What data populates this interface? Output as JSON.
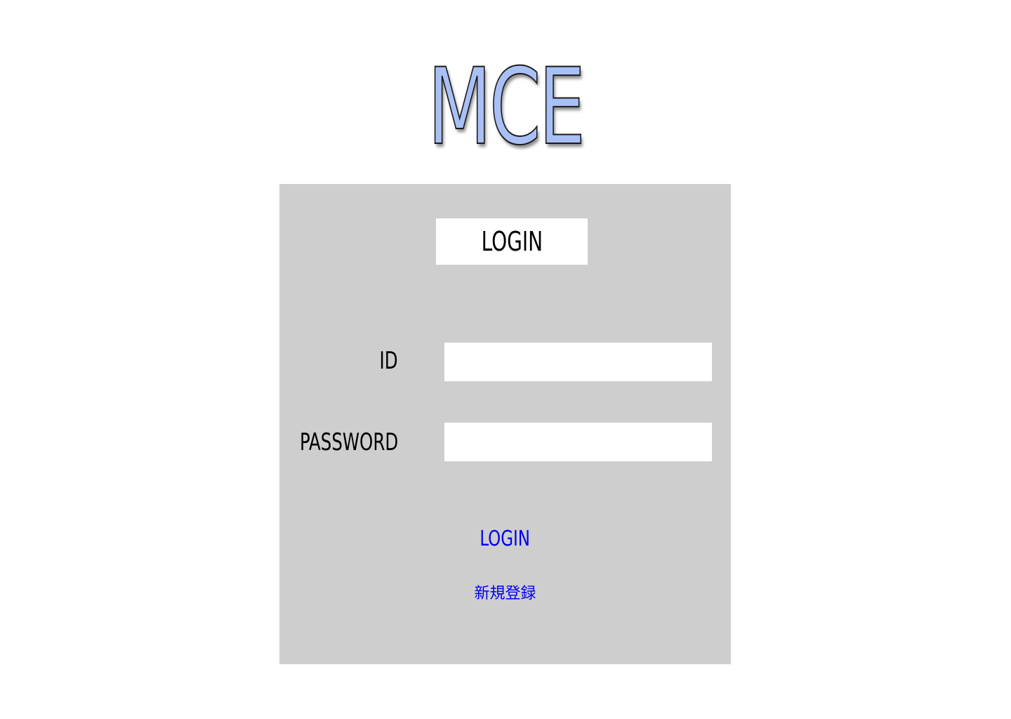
{
  "logo": {
    "text": "MCE"
  },
  "login_form": {
    "title": "LOGIN",
    "id_label": "ID",
    "id_value": "",
    "password_label": "PASSWORD",
    "password_value": "",
    "login_link": "LOGIN",
    "register_link": "新規登録"
  },
  "colors": {
    "logo_fill": "#a9c0f5",
    "panel_background": "#cecece",
    "link": "#0000ee"
  }
}
